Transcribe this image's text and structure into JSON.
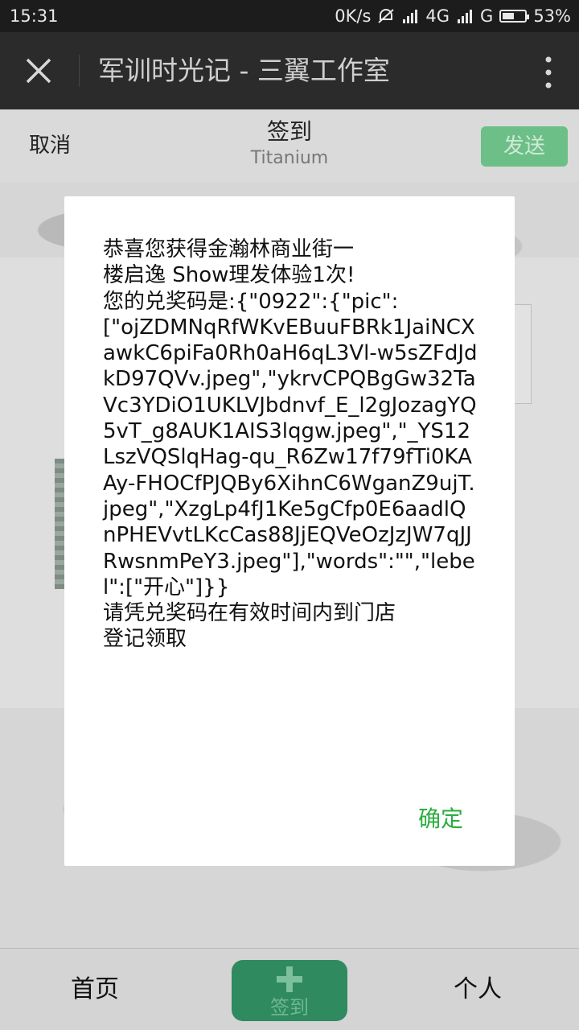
{
  "status_bar": {
    "time": "15:31",
    "network_speed": "0K/s",
    "signal_1": "4G",
    "signal_2": "G",
    "battery": "53%",
    "battery_level": 0.53
  },
  "title_bar": {
    "title": "军训时光记 - 三翼工作室",
    "close_icon": "close-icon",
    "more_icon": "more-vertical-icon"
  },
  "sub_header": {
    "cancel": "取消",
    "title": "签到",
    "subtitle": "Titanium",
    "send": "发送"
  },
  "dialog": {
    "message": "恭喜您获得金瀚林商业街一\n楼启逸 Show理发体验1次!\n您的兑奖码是:{\"0922\":{\"pic\":\n[\"ojZDMNqRfWKvEBuuFBRk1JaiNCXawkC6piFa0Rh0aH6qL3Vl-w5sZFdJdkD97QVv.jpeg\",\"ykrvCPQBgGw32TaVc3YDiO1UKLVJbdnvf_E_l2gJozagYQ5vT_g8AUK1AIS3lqgw.jpeg\",\"_YS12LszVQSlqHag-qu_R6Zw17f79fTi0KAAy-FHOCfPJQBy6XihnC6WganZ9ujT.jpeg\",\"XzgLp4fJ1Ke5gCfp0E6aadlQnPHEVvtLKcCas88JjEQVeOzJzJW7qJJRwsnmPeY3.jpeg\"],\"words\":\"\",\"lebel\":[\"开心\"]}}\n请凭兑奖码在有效时间内到门店\n登记领取",
    "confirm": "确定"
  },
  "bottom_nav": {
    "home": "首页",
    "checkin": "签到",
    "me": "个人"
  },
  "colors": {
    "accent_green": "#2aae3f",
    "send_button": "#6cbf86",
    "checkin_button": "#2f8a5f",
    "title_bar": "#2b2b2b",
    "status_bar": "#1c1c1c"
  }
}
